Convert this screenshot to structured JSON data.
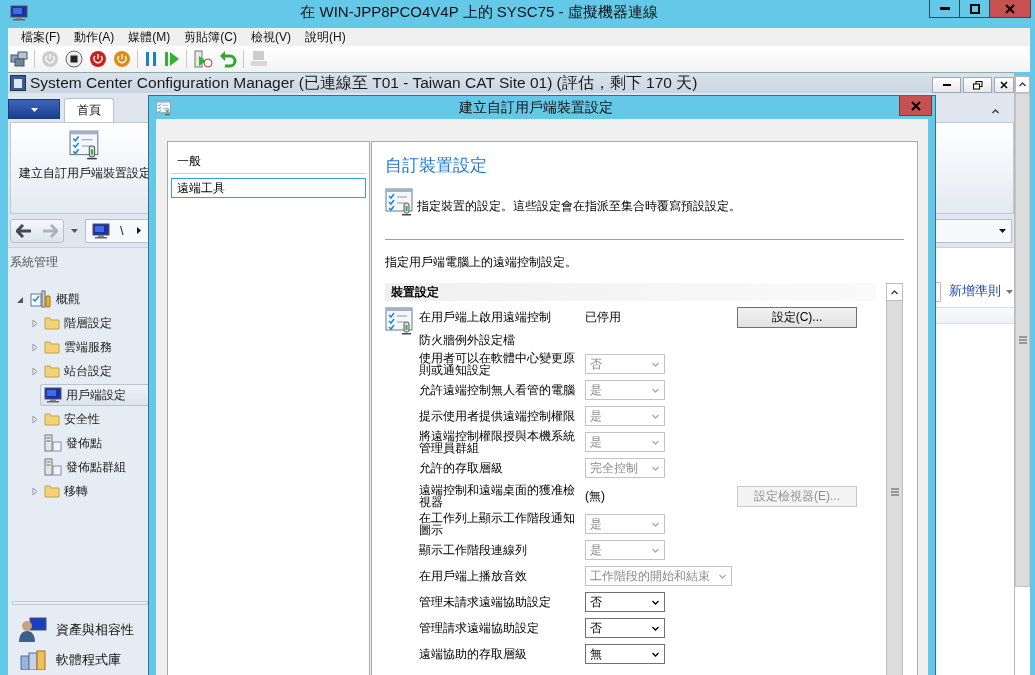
{
  "vm_window": {
    "title": "在 WIN-JPP8PCO4V4P 上的 SYSC75 - 虛擬機器連線"
  },
  "menu": [
    "檔案(F)",
    "動作(A)",
    "媒體(M)",
    "剪貼簿(C)",
    "檢視(V)",
    "說明(H)"
  ],
  "toolbar": [
    {
      "kind": "keyboard",
      "disabled": false
    },
    {
      "kind": "separator"
    },
    {
      "kind": "start",
      "disabled": true
    },
    {
      "kind": "turn_off",
      "disabled": false
    },
    {
      "kind": "shutdown",
      "disabled": false
    },
    {
      "kind": "power",
      "disabled": false
    },
    {
      "kind": "separator"
    },
    {
      "kind": "pause",
      "disabled": false
    },
    {
      "kind": "resume",
      "disabled": false
    },
    {
      "kind": "separator"
    },
    {
      "kind": "checkpoint",
      "disabled": false
    },
    {
      "kind": "revert",
      "disabled": false
    },
    {
      "kind": "separator"
    },
    {
      "kind": "enhanced",
      "disabled": true
    }
  ],
  "console": {
    "title": "System Center Configuration Manager (已連線至 T01 - Taiwan CAT Site 01) (評估，剩下 170 天)",
    "ribbon_tabs": [
      {
        "label": "首頁",
        "selected": true
      }
    ],
    "ribbon_button": "建立自訂用戶端裝置設定",
    "breadcrumb": "\\",
    "nav_heading": "系統管理",
    "tree": [
      {
        "label": "概觀",
        "kind": "overview",
        "expanded": true,
        "selected": false,
        "children": [
          {
            "label": "階層設定",
            "kind": "folder",
            "expanded": false,
            "selected": false
          },
          {
            "label": "雲端服務",
            "kind": "folder",
            "expanded": false,
            "selected": false
          },
          {
            "label": "站台設定",
            "kind": "folder",
            "expanded": false,
            "selected": false
          },
          {
            "label": "用戶端設定",
            "kind": "monitor",
            "selected": true
          },
          {
            "label": "安全性",
            "kind": "folder",
            "expanded": false,
            "selected": false
          },
          {
            "label": "發佈點",
            "kind": "server",
            "selected": false
          },
          {
            "label": "發佈點群組",
            "kind": "servers",
            "selected": false
          },
          {
            "label": "移轉",
            "kind": "folder",
            "expanded": false,
            "selected": false
          }
        ]
      }
    ],
    "workspaces": [
      {
        "label": "資產與相容性",
        "kind": "assets"
      },
      {
        "label": "軟體程式庫",
        "kind": "library"
      }
    ],
    "new_criteria": "新增準則"
  },
  "dialog": {
    "title": "建立自訂用戶端裝置設定",
    "pages": [
      {
        "label": "一般",
        "kind": "header",
        "selected": false
      },
      {
        "label": "遠端工具",
        "kind": "page",
        "selected": true
      }
    ],
    "heading": "自訂裝置設定",
    "description": "指定裝置的設定。這些設定會在指派至集合時覆寫預設設定。",
    "intro": "指定用戶端電腦上的遠端控制設定。",
    "group": {
      "title": "裝置設定",
      "rows": [
        {
          "kind": "status",
          "label": "在用戶端上啟用遠端控制",
          "value": "已停用",
          "button": "設定(C)...",
          "button_disabled": false
        },
        {
          "kind": "label",
          "label": "防火牆例外設定檔"
        },
        {
          "kind": "select",
          "label": "使用者可以在軟體中心變更原則或通知設定",
          "value": "否",
          "disabled": true
        },
        {
          "kind": "select",
          "label": "允許遠端控制無人看管的電腦",
          "value": "是",
          "disabled": true
        },
        {
          "kind": "select",
          "label": "提示使用者提供遠端控制權限",
          "value": "是",
          "disabled": true
        },
        {
          "kind": "select",
          "label": "將遠端控制權限授與本機系統管理員群組",
          "value": "是",
          "disabled": true
        },
        {
          "kind": "select",
          "label": "允許的存取層級",
          "value": "完全控制",
          "disabled": true
        },
        {
          "kind": "value",
          "label": "遠端控制和遠端桌面的獲准檢視器",
          "value": "(無)",
          "button": "設定檢視器(E)...",
          "button_disabled": true
        },
        {
          "kind": "select",
          "label": "在工作列上顯示工作階段通知圖示",
          "value": "是",
          "disabled": true
        },
        {
          "kind": "select",
          "label": "顯示工作階段連線列",
          "value": "是",
          "disabled": true
        },
        {
          "kind": "select",
          "label": "在用戶端上播放音效",
          "value": "工作階段的開始和結束",
          "disabled": true
        },
        {
          "kind": "select",
          "label": "管理未請求遠端協助設定",
          "value": "否",
          "disabled": false
        },
        {
          "kind": "select",
          "label": "管理請求遠端協助設定",
          "value": "否",
          "disabled": false
        },
        {
          "kind": "select",
          "label": "遠端協助的存取層級",
          "value": "無",
          "disabled": false
        }
      ]
    }
  }
}
